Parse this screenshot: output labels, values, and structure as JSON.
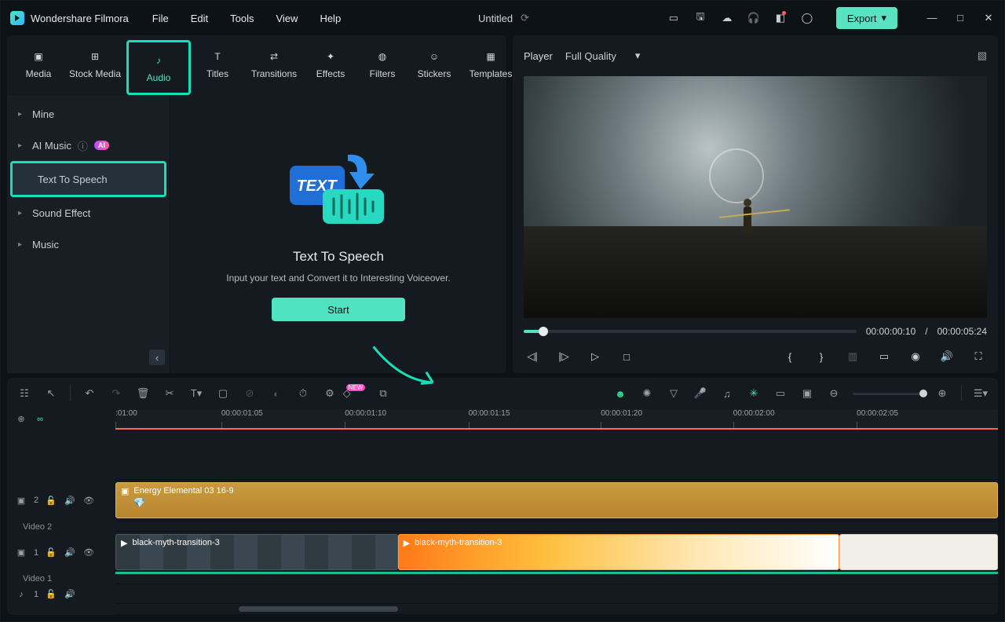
{
  "app_name": "Wondershare Filmora",
  "menus": [
    "File",
    "Edit",
    "Tools",
    "View",
    "Help"
  ],
  "doc_title": "Untitled",
  "export_label": "Export",
  "media_tabs": [
    {
      "label": "Media",
      "icon": "media-icon"
    },
    {
      "label": "Stock Media",
      "icon": "stock-icon"
    },
    {
      "label": "Audio",
      "icon": "audio-icon"
    },
    {
      "label": "Titles",
      "icon": "titles-icon"
    },
    {
      "label": "Transitions",
      "icon": "transitions-icon"
    },
    {
      "label": "Effects",
      "icon": "effects-icon"
    },
    {
      "label": "Filters",
      "icon": "filters-icon"
    },
    {
      "label": "Stickers",
      "icon": "stickers-icon"
    },
    {
      "label": "Templates",
      "icon": "templates-icon"
    }
  ],
  "active_media_tab": 2,
  "sidebar_items": [
    {
      "label": "Mine",
      "expandable": true
    },
    {
      "label": "AI Music",
      "expandable": true,
      "badge": "AI",
      "help": true
    },
    {
      "label": "Text To Speech",
      "expandable": false,
      "selected": true,
      "highlighted": true
    },
    {
      "label": "Sound Effect",
      "expandable": true
    },
    {
      "label": "Music",
      "expandable": true
    }
  ],
  "tts": {
    "title": "Text To Speech",
    "subtitle": "Input your text and Convert it to Interesting Voiceover.",
    "start_label": "Start"
  },
  "player": {
    "tab": "Player",
    "quality": "Full Quality",
    "current": "00:00:00:10",
    "total": "00:00:05:24",
    "progress_pct": 6
  },
  "ruler_ticks": [
    ":01:00",
    "00:00:01:05",
    "00:00:01:10",
    "00:00:01:15",
    "00:00:01:20",
    "00:00:02:00",
    "00:00:02:05"
  ],
  "tracks": {
    "video2": {
      "label": "Video 2",
      "badge": "2",
      "clip": "Energy Elemental 03 16-9"
    },
    "video1": {
      "label": "Video 1",
      "badge": "1",
      "clipA": "black-myth-transition-3",
      "clipB": "black-myth-transition-3"
    },
    "audio1": {
      "badge": "1"
    }
  },
  "new_label": "NEW",
  "colors": {
    "accent": "#4fe3c1",
    "highlight": "#15e0b8"
  }
}
